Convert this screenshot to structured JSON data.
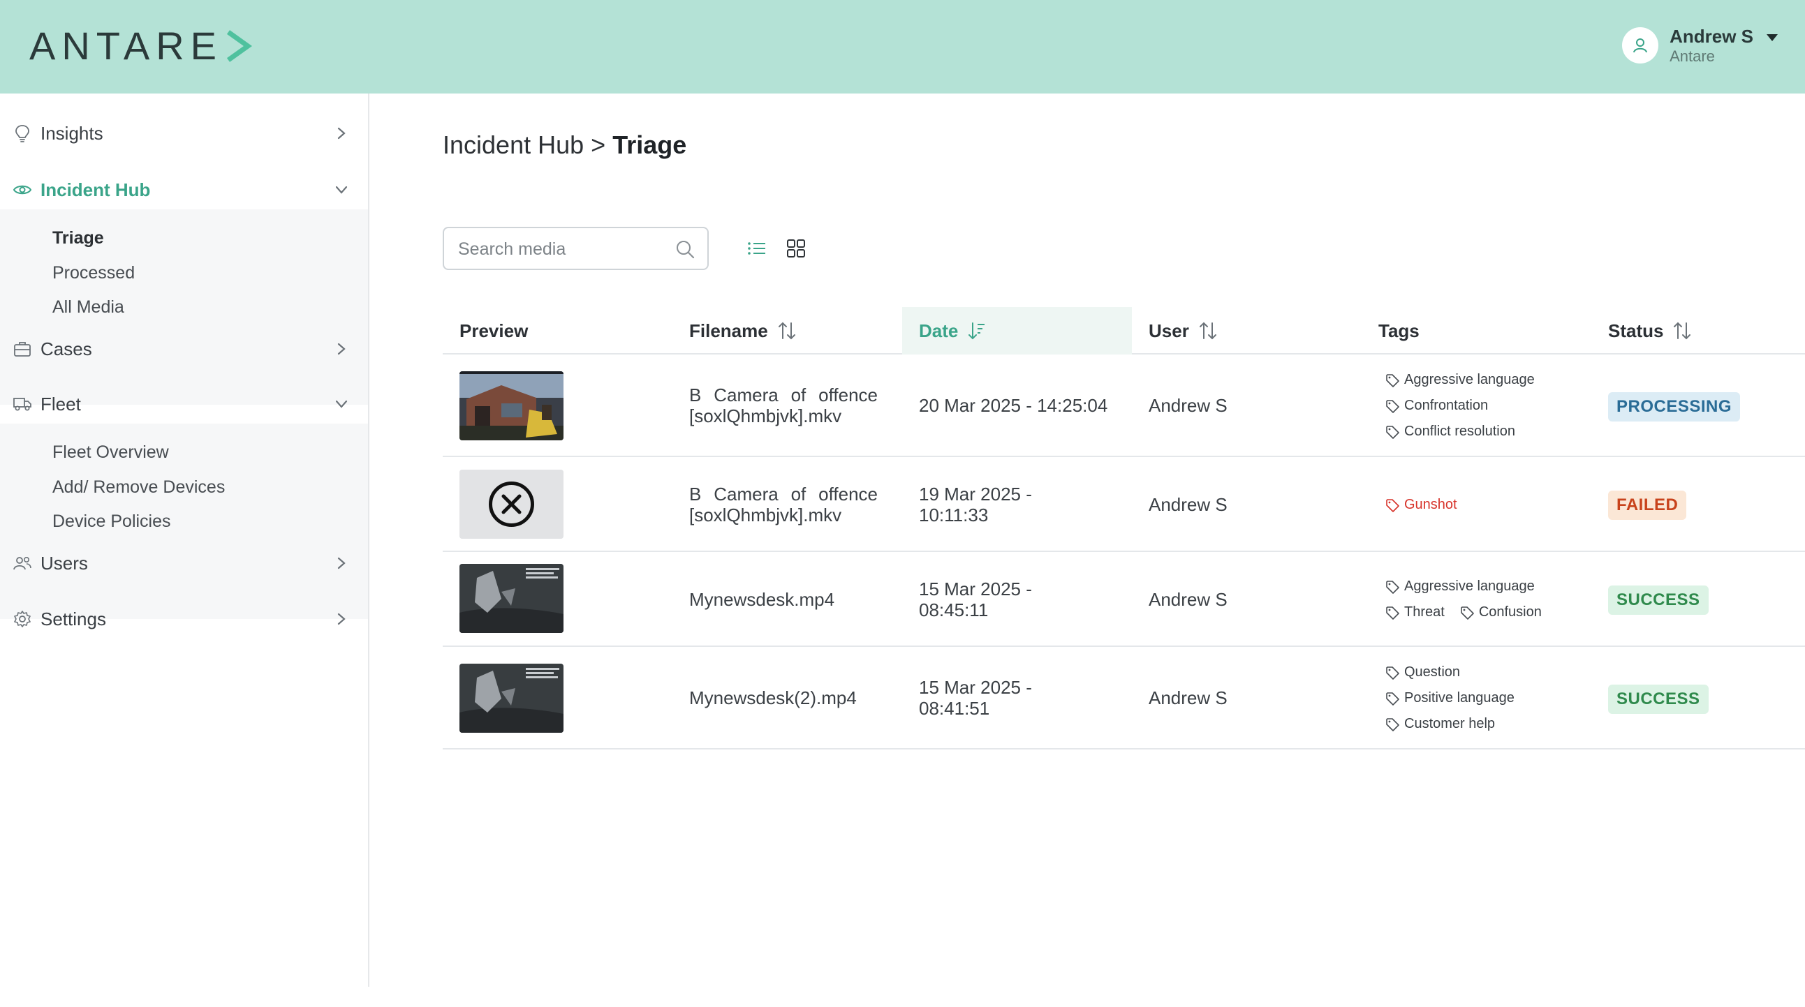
{
  "header": {
    "logo_text": "ANTARE",
    "user_name": "Andrew S",
    "user_org": "Antare",
    "brand_color": "#b4e2d6",
    "accent_color": "#3aa489"
  },
  "sidebar": {
    "items": [
      {
        "label": "Insights",
        "icon": "lightbulb-icon"
      },
      {
        "label": "Incident Hub",
        "icon": "eye-icon",
        "expanded": true,
        "active": true
      },
      {
        "label": "Cases",
        "icon": "briefcase-icon"
      },
      {
        "label": "Fleet",
        "icon": "truck-icon",
        "expanded": true
      },
      {
        "label": "Users",
        "icon": "users-icon"
      },
      {
        "label": "Settings",
        "icon": "gear-icon"
      }
    ],
    "incident_hub_sub": [
      "Triage",
      "Processed",
      "All Media"
    ],
    "fleet_sub": [
      "Fleet Overview",
      "Add/ Remove Devices",
      "Device Policies"
    ]
  },
  "breadcrumb": {
    "parent": "Incident Hub",
    "separator": ">",
    "current": "Triage"
  },
  "search": {
    "placeholder": "Search media",
    "value": ""
  },
  "table": {
    "columns": [
      "Preview",
      "Filename",
      "Date",
      "User",
      "Tags",
      "Status"
    ],
    "sorted_column": "Date",
    "rows": [
      {
        "preview": "video-thumbnail",
        "filename_line1": "B Camera of offence",
        "filename_line2": "[soxlQhmbjvk].mkv",
        "date_line1": "20 Mar 2025 - 14:25:04",
        "date_line2": "",
        "user": "Andrew S",
        "tags": [
          [
            "Aggressive language"
          ],
          [
            "Confrontation"
          ],
          [
            "Conflict resolution"
          ]
        ],
        "status": "PROCESSING"
      },
      {
        "preview": "failed-icon",
        "filename_line1": "B Camera of offence",
        "filename_line2": "[soxlQhmbjvk].mkv",
        "date_line1": "19 Mar 2025 -",
        "date_line2": "10:11:33",
        "user": "Andrew S",
        "tags": [
          [
            "Gunshot"
          ]
        ],
        "status": "FAILED"
      },
      {
        "preview": "video-thumbnail",
        "filename_line1": "Mynewsdesk.mp4",
        "filename_line2": "",
        "date_line1": "15 Mar 2025 -",
        "date_line2": "08:45:11",
        "user": "Andrew S",
        "tags": [
          [
            "Aggressive language"
          ],
          [
            "Threat",
            "Confusion"
          ]
        ],
        "status": "SUCCESS"
      },
      {
        "preview": "video-thumbnail",
        "filename_line1": "Mynewsdesk(2).mp4",
        "filename_line2": "",
        "date_line1": "15 Mar 2025 -",
        "date_line2": "08:41:51",
        "user": "Andrew S",
        "tags": [
          [
            "Question"
          ],
          [
            "Positive language"
          ],
          [
            "Customer help"
          ]
        ],
        "status": "SUCCESS"
      }
    ]
  }
}
